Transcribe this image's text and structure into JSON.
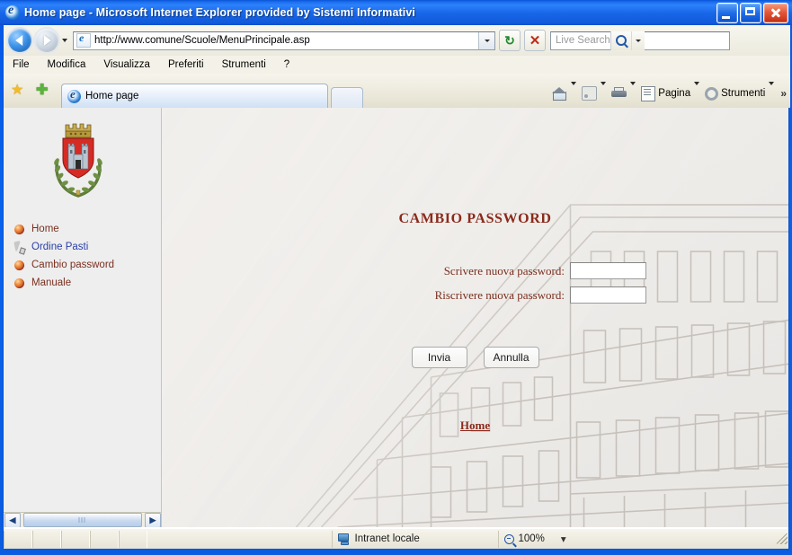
{
  "window": {
    "title": "Home page - Microsoft Internet Explorer provided by Sistemi Informativi",
    "controls": {
      "minimize": "Minimize",
      "maximize": "Maximize",
      "close": "Close"
    }
  },
  "toolbar": {
    "back": "Back",
    "forward": "Forward",
    "address_value": "http://www.comune/Scuole/MenuPrincipale.asp",
    "refresh_glyph": "↻",
    "stop_glyph": "✕",
    "search_placeholder": "Live Search"
  },
  "menu": {
    "items": [
      {
        "label": "File",
        "accel": "F"
      },
      {
        "label": "Modifica",
        "accel": "d"
      },
      {
        "label": "Visualizza",
        "accel": "V"
      },
      {
        "label": "Preferiti",
        "accel": "P"
      },
      {
        "label": "Strumenti",
        "accel": "S"
      },
      {
        "label": "?",
        "accel": ""
      }
    ]
  },
  "tabs": {
    "favorites_label": "Centro preferiti",
    "addfav_label": "Aggiungi a Preferiti",
    "open": [
      {
        "label": "Home page",
        "active": true
      }
    ],
    "newtab_label": "Nuova scheda"
  },
  "commandbar": {
    "home_label": "",
    "feeds_label": "",
    "print_label": "",
    "page_label": "Pagina",
    "tools_label": "Strumenti",
    "overflow": "»"
  },
  "sidebar": {
    "crest_alt": "Stemma del Comune",
    "items": [
      {
        "label": "Home",
        "icon": "bullet-sphere-icon",
        "style": "maroon"
      },
      {
        "label": "Ordine Pasti",
        "icon": "cursor-pointer-icon",
        "style": "blue"
      },
      {
        "label": "Cambio password",
        "icon": "bullet-sphere-icon",
        "style": "maroon"
      },
      {
        "label": "Manuale",
        "icon": "bullet-sphere-icon",
        "style": "maroon"
      }
    ],
    "scroll_left": "◀",
    "scroll_right": "▶"
  },
  "main": {
    "heading": "CAMBIO PASSWORD",
    "fields": [
      {
        "label": "Scrivere nuova password:",
        "value": "",
        "name": "new-password-field"
      },
      {
        "label": "Riscrivere nuova password:",
        "value": "",
        "name": "confirm-password-field"
      }
    ],
    "buttons": [
      {
        "label": "Invia",
        "name": "submit-button"
      },
      {
        "label": "Annulla",
        "name": "cancel-button"
      }
    ],
    "home_link": "Home"
  },
  "statusbar": {
    "zone": "Intranet locale",
    "zoom": "100%",
    "zoom_caret": "▾"
  },
  "colors": {
    "accent_maroon": "#8b2a1c",
    "link_blue": "#2a3fa8",
    "titlebar_blue": "#1968ea",
    "chrome_tan": "#f4f2e8"
  }
}
